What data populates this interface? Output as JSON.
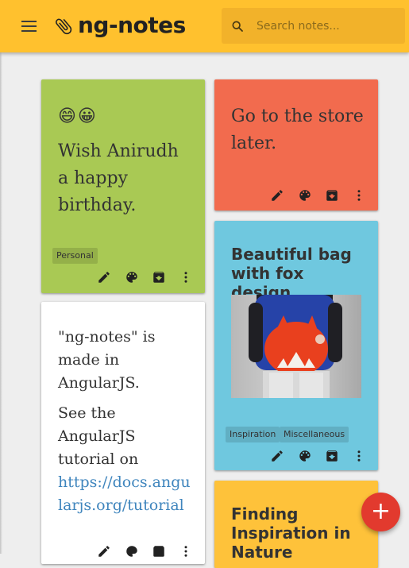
{
  "header": {
    "title": "ng-notes",
    "search_placeholder": "Search notes..."
  },
  "colors": {
    "header": "#ffc12e",
    "green": "#a9c954",
    "red": "#f26b4e",
    "blue": "#6fc8df",
    "yellow": "#fec23a",
    "white": "#ffffff",
    "fab": "#e23a2e"
  },
  "notes": [
    {
      "color": "green",
      "emoji": "😄😀",
      "text": "Wish Anirudh a happy birthday.",
      "tags": [
        "Personal"
      ]
    },
    {
      "color": "red",
      "text": "Go to the store later."
    },
    {
      "color": "blue",
      "title": "Beautiful bag with fox design",
      "image": "photo of person holding red fox-design bag",
      "tags": [
        "Inspiration",
        "Miscellaneous"
      ]
    },
    {
      "color": "white",
      "para1": "\"ng-notes\" is made in AngularJS.",
      "para2": "See the AngularJS tutorial on",
      "link": "https://docs.angularjs.org/tutorial"
    },
    {
      "color": "yellow",
      "title": "Finding Inspiration in Nature"
    }
  ],
  "icons": {
    "edit": "pencil-icon",
    "color": "palette-icon",
    "archive": "archive-icon",
    "more": "more-vert-icon",
    "add": "+"
  }
}
